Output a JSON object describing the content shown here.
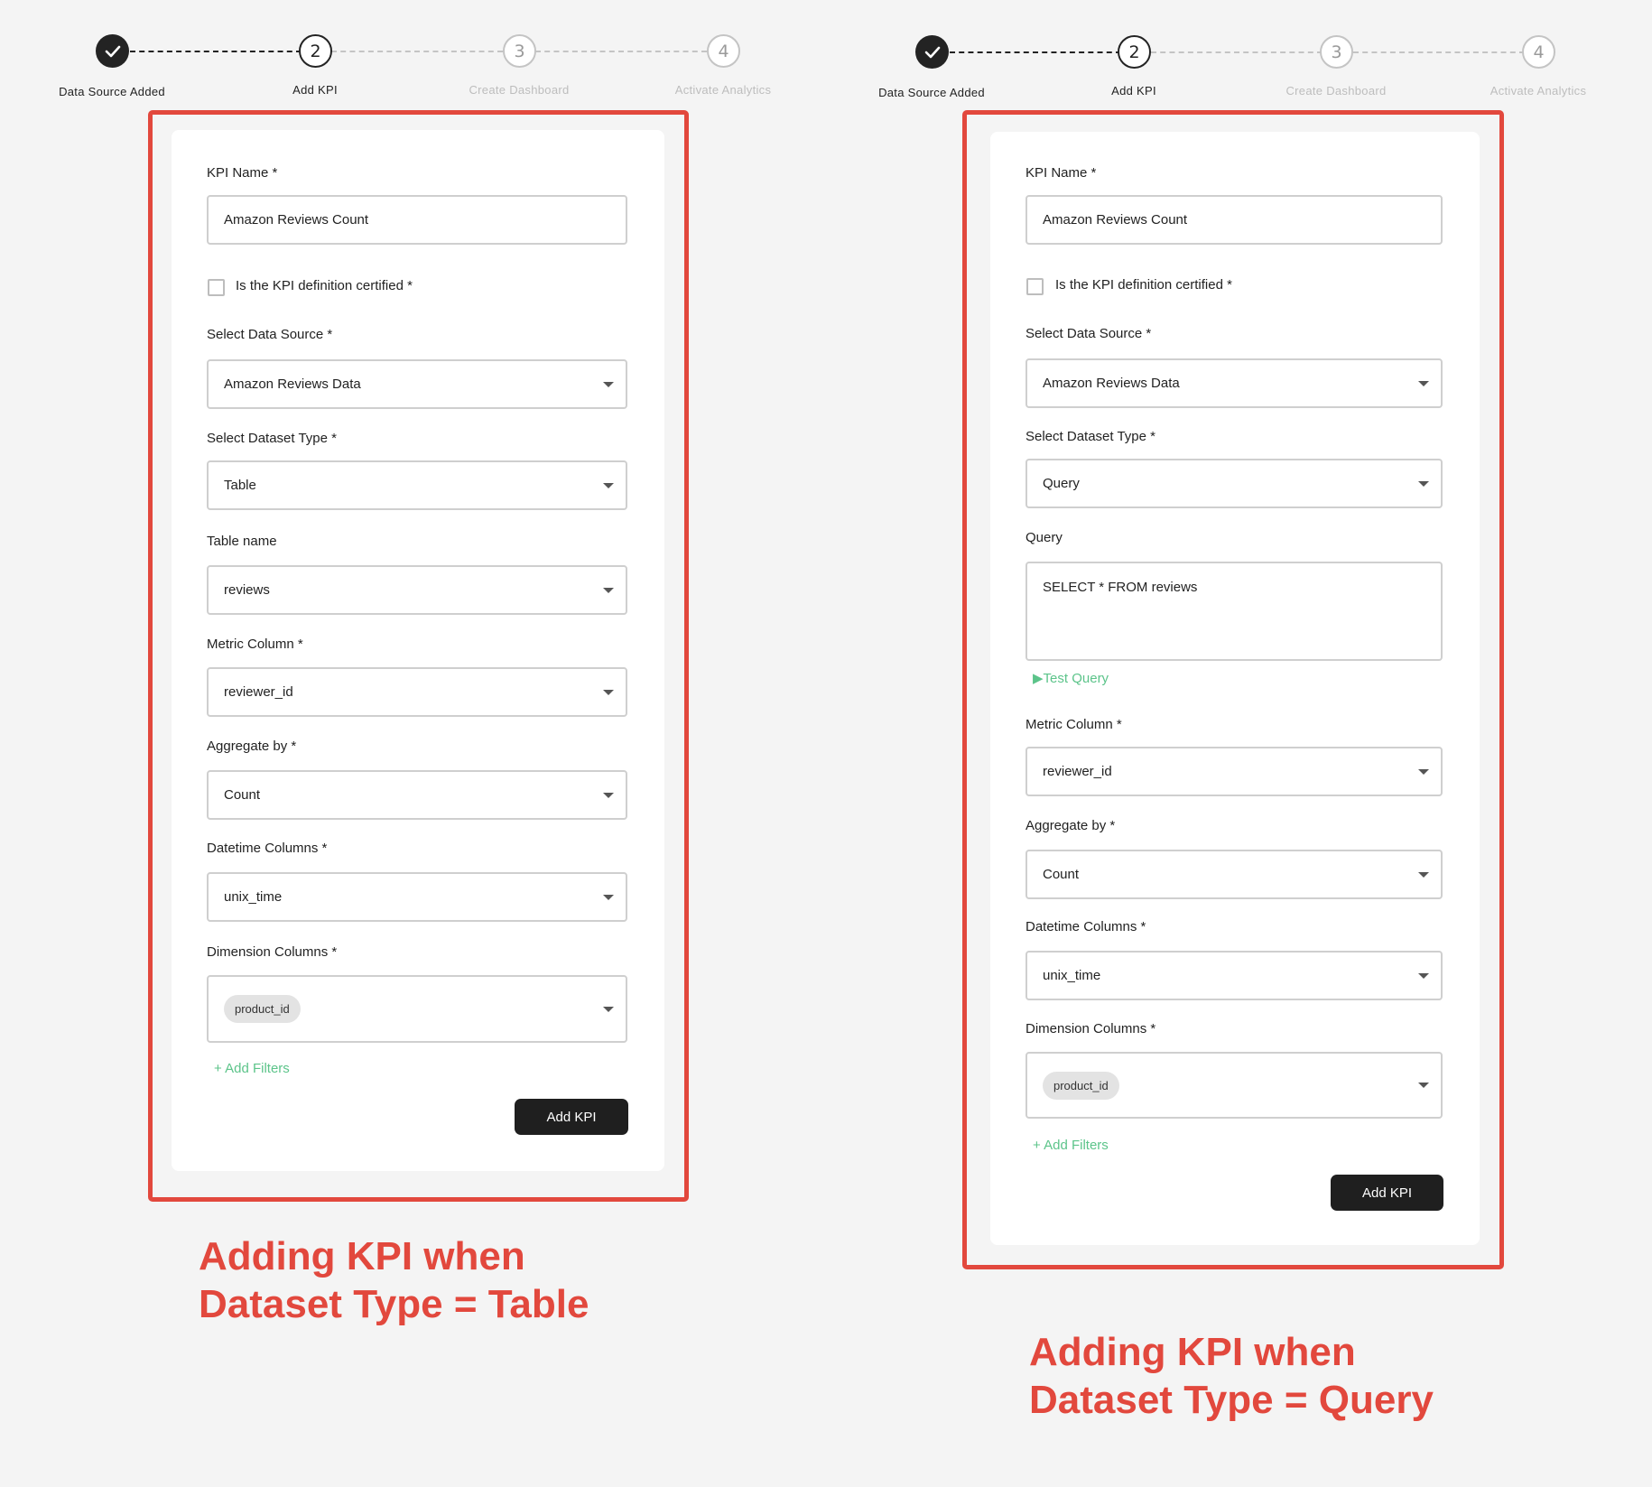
{
  "steps": [
    {
      "number": "",
      "label": "Data Source Added",
      "state": "done",
      "icon": "check-icon"
    },
    {
      "number": "2",
      "label": "Add KPI",
      "state": "active"
    },
    {
      "number": "3",
      "label": "Create Dashboard",
      "state": "todo"
    },
    {
      "number": "4",
      "label": "Activate Analytics",
      "state": "todo"
    }
  ],
  "table_form": {
    "kpi_name_label": "KPI Name *",
    "kpi_name_value": "Amazon Reviews Count",
    "certified_label": "Is the KPI definition certified *",
    "data_source_label": "Select Data Source *",
    "data_source_value": "Amazon Reviews Data",
    "dataset_type_label": "Select Dataset Type *",
    "dataset_type_value": "Table",
    "table_name_label": "Table name",
    "table_name_value": "reviews",
    "metric_column_label": "Metric Column *",
    "metric_column_value": "reviewer_id",
    "aggregate_label": "Aggregate by *",
    "aggregate_value": "Count",
    "datetime_label": "Datetime Columns *",
    "datetime_value": "unix_time",
    "dimension_label": "Dimension Columns *",
    "dimension_chip": "product_id",
    "add_filters": "+ Add Filters",
    "submit": "Add KPI",
    "caption_line1": "Adding KPI when",
    "caption_line2": "Dataset Type = Table"
  },
  "query_form": {
    "kpi_name_label": "KPI Name *",
    "kpi_name_value": "Amazon Reviews Count",
    "certified_label": "Is the KPI definition certified *",
    "data_source_label": "Select Data Source *",
    "data_source_value": "Amazon Reviews Data",
    "dataset_type_label": "Select Dataset Type *",
    "dataset_type_value": "Query",
    "query_label": "Query",
    "query_value": "SELECT * FROM reviews",
    "test_query": "▶Test Query",
    "metric_column_label": "Metric Column *",
    "metric_column_value": "reviewer_id",
    "aggregate_label": "Aggregate by *",
    "aggregate_value": "Count",
    "datetime_label": "Datetime Columns *",
    "datetime_value": "unix_time",
    "dimension_label": "Dimension Columns *",
    "dimension_chip": "product_id",
    "add_filters": "+ Add Filters",
    "submit": "Add KPI",
    "caption_line1": "Adding KPI when",
    "caption_line2": "Dataset Type = Query"
  },
  "colors": {
    "frame": "#e2483d",
    "link": "#5cc48a",
    "button": "#1f1f1f"
  }
}
